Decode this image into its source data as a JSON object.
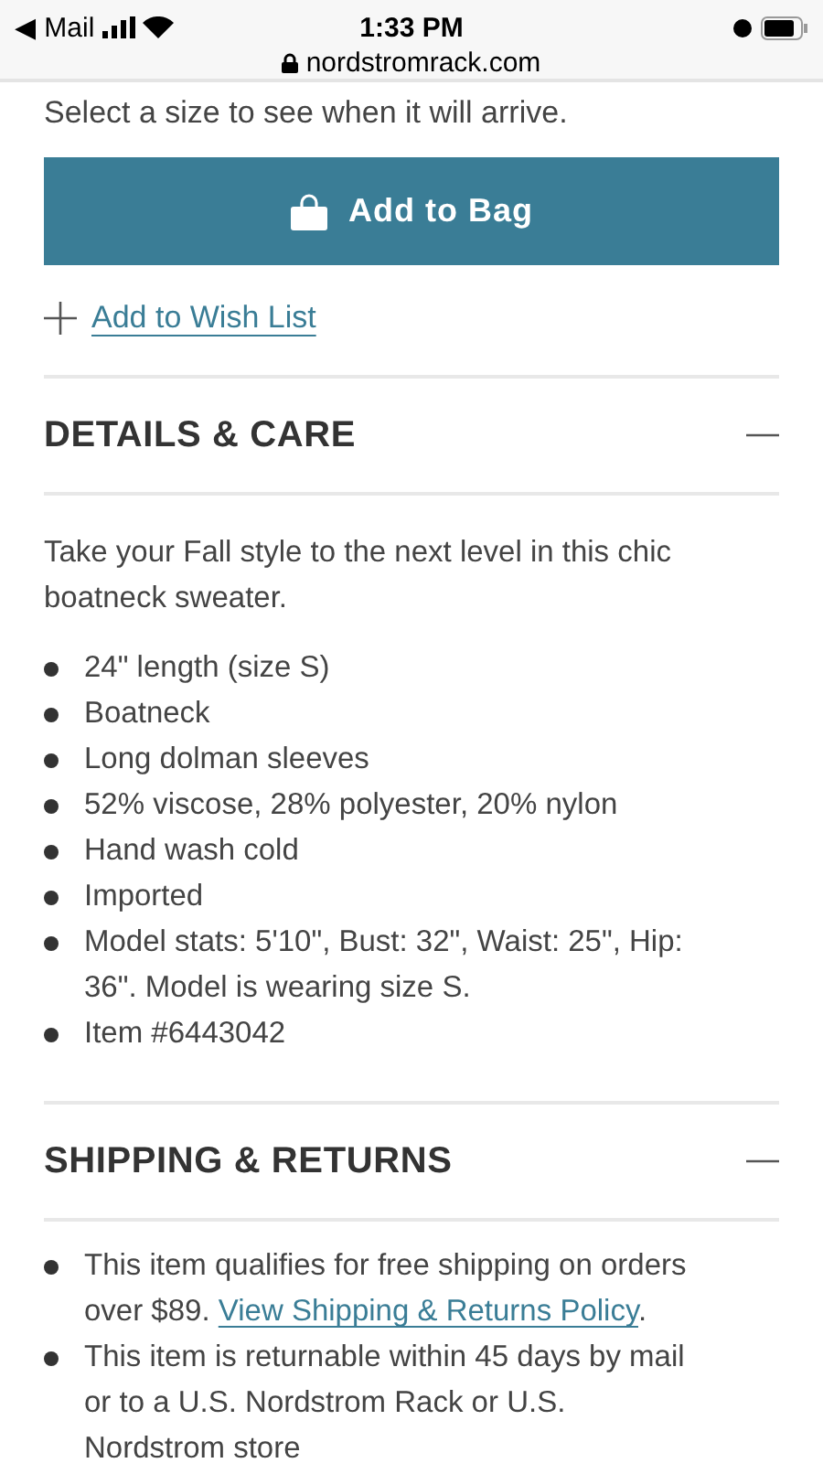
{
  "status_bar": {
    "back_app": "◀ Mail",
    "time": "1:33 PM",
    "url": "nordstromrack.com"
  },
  "delivery_note": "Select a size to see when it will arrive.",
  "add_to_bag": {
    "label": "Add to Bag"
  },
  "wish_list": {
    "label": "Add to Wish List"
  },
  "sections": [
    {
      "title": "DETAILS & CARE",
      "expanded": true,
      "intro": "Take your Fall style to the next level in this chic boatneck sweater.",
      "bullets": [
        {
          "text": "24\" length (size S)"
        },
        {
          "text": "Boatneck"
        },
        {
          "text": "Long dolman sleeves"
        },
        {
          "text": "52% viscose, 28% polyester, 20% nylon"
        },
        {
          "text": "Hand wash cold"
        },
        {
          "text": "Imported"
        },
        {
          "text": "Model stats: 5'10\", Bust: 32\", Waist: 25\", Hip: 36\". Model is wearing size S."
        },
        {
          "text": "Item #6443042"
        }
      ]
    },
    {
      "title": "SHIPPING & RETURNS",
      "expanded": true,
      "bullets": [
        {
          "text": "This item qualifies for free shipping on orders over $89.",
          "link": "View Shipping & Returns Policy",
          "after": "."
        },
        {
          "text": "This item is returnable within 45 days by mail or to a U.S. Nordstrom Rack or U.S. Nordstrom store"
        }
      ]
    }
  ]
}
